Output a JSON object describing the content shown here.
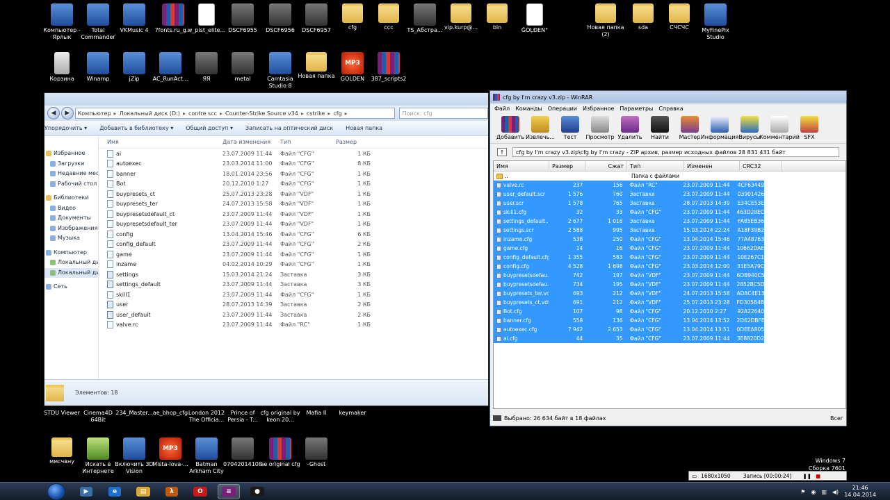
{
  "desktop": {
    "icons": [
      {
        "label": "Компьютер - Ярлык",
        "icon": "computer-icon"
      },
      {
        "label": "Total Commander",
        "icon": "floppy-icon"
      },
      {
        "label": "VKMusic 4",
        "icon": "music-note-icon"
      },
      {
        "label": "7fonts.ru_g...",
        "icon": "rar-archive-icon"
      },
      {
        "label": "w_pist_elite...",
        "icon": "tga-file-icon"
      },
      {
        "label": "DSCF6955",
        "icon": "photo-icon"
      },
      {
        "label": "DSCF6956",
        "icon": "photo-icon"
      },
      {
        "label": "DSCF6957",
        "icon": "photo-icon"
      },
      {
        "label": "cfg",
        "icon": "folder-icon"
      },
      {
        "label": "ccc",
        "icon": "folder-icon"
      },
      {
        "label": "TS_Абстра...",
        "icon": "photo-icon"
      },
      {
        "label": "vip.kurp@...",
        "icon": "folder-icon"
      },
      {
        "label": "bin",
        "icon": "folder-icon"
      },
      {
        "label": "ĞÖĻĐEN°",
        "icon": "document-icon"
      },
      {
        "label": "Новая папка (2)",
        "icon": "folder-icon"
      },
      {
        "label": "sda",
        "icon": "folder-icon"
      },
      {
        "label": "СЧСЧС",
        "icon": "folder-icon"
      },
      {
        "label": "MyFinePix Studio",
        "icon": "camera-app-icon"
      },
      {
        "label": "Корзина",
        "icon": "recycle-bin-icon"
      },
      {
        "label": "Winamp",
        "icon": "winamp-icon"
      },
      {
        "label": "jZip",
        "icon": "zip-app-icon"
      },
      {
        "label": "AC_RunAct...",
        "icon": "script-icon"
      },
      {
        "label": "ЯЯ",
        "icon": "photo-icon"
      },
      {
        "label": "metal",
        "icon": "photo-icon"
      },
      {
        "label": "Camtasia Studio 8",
        "icon": "camtasia-icon"
      },
      {
        "label": "Новая папка",
        "icon": "folder-icon"
      },
      {
        "label": "GOLDEN",
        "icon": "mp3-icon"
      },
      {
        "label": "387_scripts2",
        "icon": "rar-archive-icon"
      },
      {
        "label": "STDU Viewer",
        "icon": "app-icon"
      },
      {
        "label": "Cinema4D 64Bit",
        "icon": "app-icon"
      },
      {
        "label": "234_Master...",
        "icon": "app-icon"
      },
      {
        "label": "ae_bhop_cfg",
        "icon": "app-icon"
      },
      {
        "label": "London 2012 The Officia...",
        "icon": "app-icon"
      },
      {
        "label": "Prince of Persia - T...",
        "icon": "app-icon"
      },
      {
        "label": "cfg original by keon 20...",
        "icon": "app-icon"
      },
      {
        "label": "Mafia II",
        "icon": "app-icon"
      },
      {
        "label": "keymaker",
        "icon": "app-icon"
      },
      {
        "label": "ммсчвну",
        "icon": "folder-icon"
      },
      {
        "label": "Искать в Интернете",
        "icon": "search-web-icon"
      },
      {
        "label": "Включить 3D Vision",
        "icon": "nvidia-icon"
      },
      {
        "label": "Mista-lova-...",
        "icon": "mp3-icon"
      },
      {
        "label": "Batman Arkham City",
        "icon": "batman-icon"
      },
      {
        "label": "07042014108",
        "icon": "photo-icon"
      },
      {
        "label": "ae original cfg",
        "icon": "rar-archive-icon"
      },
      {
        "label": "-Ghost",
        "icon": "photo-icon"
      }
    ]
  },
  "explorer": {
    "address": [
      "Компьютер",
      "Локальный диск (D:)",
      "contre scc",
      "Counter-Strike Source v34",
      "cstrike",
      "cfg"
    ],
    "search_placeholder": "Поиск: cfg",
    "toolbar": [
      "Упорядочить ▾",
      "Добавить в библиотеку ▾",
      "Общий доступ ▾",
      "Записать на оптический диск",
      "Новая папка"
    ],
    "nav": [
      {
        "label": "Избранное",
        "group": true,
        "color": "y"
      },
      {
        "label": "Загрузки",
        "group": false,
        "color": "b"
      },
      {
        "label": "Недавние мес",
        "group": false,
        "color": "b"
      },
      {
        "label": "Рабочий стол",
        "group": false,
        "color": "b"
      },
      {
        "label": "Библиотеки",
        "group": true,
        "color": "y"
      },
      {
        "label": "Видео",
        "group": false,
        "color": "b"
      },
      {
        "label": "Документы",
        "group": false,
        "color": "b"
      },
      {
        "label": "Изображения",
        "group": false,
        "color": "b"
      },
      {
        "label": "Музыка",
        "group": false,
        "color": "b"
      },
      {
        "label": "Компьютер",
        "group": true,
        "color": "b"
      },
      {
        "label": "Локальный ди",
        "group": false,
        "color": "g"
      },
      {
        "label": "Локальный ди",
        "group": false,
        "color": "g",
        "selected": true
      },
      {
        "label": "Сеть",
        "group": true,
        "color": "b"
      }
    ],
    "columns": {
      "name": "Имя",
      "date": "Дата изменения",
      "type": "Тип",
      "size": "Размер"
    },
    "files": [
      {
        "name": "ai",
        "date": "23.07.2009 11:44",
        "type": "Файл \"CFG\"",
        "size": "1 КБ"
      },
      {
        "name": "autoexec",
        "date": "23.03.2014 11:00",
        "type": "Файл \"CFG\"",
        "size": "8 КБ"
      },
      {
        "name": "banner",
        "date": "18.01.2014 23:56",
        "type": "Файл \"CFG\"",
        "size": "1 КБ"
      },
      {
        "name": "Bot",
        "date": "20.12.2010 1:27",
        "type": "Файл \"CFG\"",
        "size": "1 КБ"
      },
      {
        "name": "buypresets_ct",
        "date": "25.07.2013 23:28",
        "type": "Файл \"VDF\"",
        "size": "1 КБ"
      },
      {
        "name": "buypresets_ter",
        "date": "24.07.2013 15:58",
        "type": "Файл \"VDF\"",
        "size": "1 КБ"
      },
      {
        "name": "buypresetsdefault_ct",
        "date": "23.07.2009 11:44",
        "type": "Файл \"VDF\"",
        "size": "1 КБ"
      },
      {
        "name": "buypresetsdefault_ter",
        "date": "23.07.2009 11:44",
        "type": "Файл \"VDF\"",
        "size": "1 КБ"
      },
      {
        "name": "config",
        "date": "13.04.2014 15:46",
        "type": "Файл \"CFG\"",
        "size": "6 КБ"
      },
      {
        "name": "config_default",
        "date": "23.07.2009 11:44",
        "type": "Файл \"CFG\"",
        "size": "2 КБ"
      },
      {
        "name": "game",
        "date": "23.07.2009 11:44",
        "type": "Файл \"CFG\"",
        "size": "1 КБ"
      },
      {
        "name": "inzame",
        "date": "04.02.2014 10:29",
        "type": "Файл \"CFG\"",
        "size": "1 КБ"
      },
      {
        "name": "settings",
        "date": "15.03.2014 21:24",
        "type": "Заставка",
        "size": "3 КБ"
      },
      {
        "name": "settings_default",
        "date": "23.07.2009 11:44",
        "type": "Заставка",
        "size": "3 КБ"
      },
      {
        "name": "skill1",
        "date": "23.07.2009 11:44",
        "type": "Файл \"CFG\"",
        "size": "1 КБ"
      },
      {
        "name": "user",
        "date": "28.07.2013 14:39",
        "type": "Заставка",
        "size": "2 КБ"
      },
      {
        "name": "user_default",
        "date": "23.07.2009 11:44",
        "type": "Заставка",
        "size": "2 КБ"
      },
      {
        "name": "valve.rc",
        "date": "23.07.2009 11:44",
        "type": "Файл \"RC\"",
        "size": "1 КБ"
      }
    ],
    "status": "Элементов: 18"
  },
  "winrar": {
    "title": "cfg by I'm crazy v3.zip - WinRAR",
    "menu": [
      "Файл",
      "Команды",
      "Операции",
      "Избранное",
      "Параметры",
      "Справка"
    ],
    "toolbar": [
      {
        "label": "Добавить",
        "cls": "ri-1"
      },
      {
        "label": "Извлечь...",
        "cls": "ri-2"
      },
      {
        "label": "Тест",
        "cls": "ri-3"
      },
      {
        "label": "Просмотр",
        "cls": "ri-4"
      },
      {
        "label": "Удалить",
        "cls": "ri-5"
      },
      {
        "label": "Найти",
        "cls": "ri-6"
      },
      {
        "label": "Мастер",
        "cls": "ri-7"
      },
      {
        "label": "Информация",
        "cls": "ri-8"
      },
      {
        "label": "Вирусы",
        "cls": "ri-9"
      },
      {
        "label": "Комментарий",
        "cls": "ri-10"
      },
      {
        "label": "SFX",
        "cls": "ri-11"
      }
    ],
    "path": "cfg by I'm crazy v3.zip\\cfg by I'm crazy - ZIP архив, размер исходных файлов 28 831 431 байт",
    "columns": {
      "name": "Имя",
      "size": "Размер",
      "packed": "Сжат",
      "type": "Тип",
      "modified": "Изменен",
      "crc": "CRC32"
    },
    "parent": {
      "name": "..",
      "type": "Папка с файлами"
    },
    "files": [
      {
        "name": "valve.rc",
        "size": "237",
        "packed": "156",
        "type": "Файл \"RC\"",
        "modified": "23.07.2009 11:44",
        "crc": "4CF63449"
      },
      {
        "name": "user_default.scr",
        "size": "1 576",
        "packed": "760",
        "type": "Заставка",
        "modified": "23.07.2009 11:44",
        "crc": "03901426"
      },
      {
        "name": "user.scr",
        "size": "1 578",
        "packed": "765",
        "type": "Заставка",
        "modified": "28.07.2013 14:39",
        "crc": "E34CE53E"
      },
      {
        "name": "skill1.cfg",
        "size": "32",
        "packed": "33",
        "type": "Файл \"CFG\"",
        "modified": "23.07.2009 11:44",
        "crc": "463D28EC"
      },
      {
        "name": "settings_default....",
        "size": "2 677",
        "packed": "1 016",
        "type": "Заставка",
        "modified": "23.07.2009 11:44",
        "crc": "FA85EB36"
      },
      {
        "name": "settings.scr",
        "size": "2 588",
        "packed": "995",
        "type": "Заставка",
        "modified": "15.03.2014 22:24",
        "crc": "A18F39B2"
      },
      {
        "name": "inzame.cfg",
        "size": "538",
        "packed": "250",
        "type": "Файл \"CFG\"",
        "modified": "13.04.2014 15:46",
        "crc": "77A48763"
      },
      {
        "name": "game.cfg",
        "size": "14",
        "packed": "16",
        "type": "Файл \"CFG\"",
        "modified": "23.07.2009 11:44",
        "crc": "10662DAE"
      },
      {
        "name": "config_default.cfg",
        "size": "1 355",
        "packed": "583",
        "type": "Файл \"CFG\"",
        "modified": "23.07.2009 11:44",
        "crc": "10E267C1"
      },
      {
        "name": "config.cfg",
        "size": "4 528",
        "packed": "1 698",
        "type": "Файл \"CFG\"",
        "modified": "23.03.2014 12:00",
        "crc": "31E5A79C"
      },
      {
        "name": "buypresetsdefau...",
        "size": "742",
        "packed": "197",
        "type": "Файл \"VDF\"",
        "modified": "23.07.2009 11:44",
        "crc": "6DB940C5"
      },
      {
        "name": "buypresetsdefau...",
        "size": "734",
        "packed": "195",
        "type": "Файл \"VDF\"",
        "modified": "23.07.2009 11:44",
        "crc": "2852BC5D"
      },
      {
        "name": "buypresets_ter.vdf",
        "size": "693",
        "packed": "212",
        "type": "Файл \"VDF\"",
        "modified": "24.07.2013 15:58",
        "crc": "ADAC4E13"
      },
      {
        "name": "buypresets_ct.vdf",
        "size": "691",
        "packed": "212",
        "type": "Файл \"VDF\"",
        "modified": "25.07.2013 23:28",
        "crc": "FD305B4B"
      },
      {
        "name": "Bot.cfg",
        "size": "107",
        "packed": "98",
        "type": "Файл \"CFG\"",
        "modified": "20.12.2010 2:27",
        "crc": "92A22640"
      },
      {
        "name": "banner.cfg",
        "size": "558",
        "packed": "136",
        "type": "Файл \"CFG\"",
        "modified": "13.04.2014 13:52",
        "crc": "2D62DBFE"
      },
      {
        "name": "autoexec.cfg",
        "size": "7 942",
        "packed": "2 653",
        "type": "Файл \"CFG\"",
        "modified": "13.04.2014 13:51",
        "crc": "0DEEA805"
      },
      {
        "name": "ai.cfg",
        "size": "44",
        "packed": "35",
        "type": "Файл \"CFG\"",
        "modified": "23.07.2009 11:44",
        "crc": "3E8820D2"
      }
    ],
    "status_left": "Выбрано: 26 634 байт в 18 файлах",
    "status_right": "Всег"
  },
  "recorder": {
    "resolution": "1680x1050",
    "record_label": "Запись [00:00:24]"
  },
  "watermark": {
    "line1": "Windows 7",
    "line2": "Сборка 7601"
  },
  "taskbar": {
    "time": "21:46",
    "date": "14.04.2014",
    "apps": [
      {
        "name": "taskbar-media-player",
        "glyph": "▶",
        "bg": "#3a6ea5"
      },
      {
        "name": "taskbar-internet-explorer",
        "glyph": "e",
        "bg": "#1e6fd0"
      },
      {
        "name": "taskbar-explorer",
        "glyph": "▤",
        "bg": "#d9a83a"
      },
      {
        "name": "taskbar-half-life",
        "glyph": "λ",
        "bg": "#c05a10"
      },
      {
        "name": "taskbar-opera",
        "glyph": "O",
        "bg": "#c41a1a"
      },
      {
        "name": "taskbar-winrar",
        "glyph": "≡",
        "bg": "#7a1f7a",
        "active": true
      },
      {
        "name": "taskbar-recorder",
        "glyph": "●",
        "bg": "#1a1a1a"
      }
    ]
  }
}
